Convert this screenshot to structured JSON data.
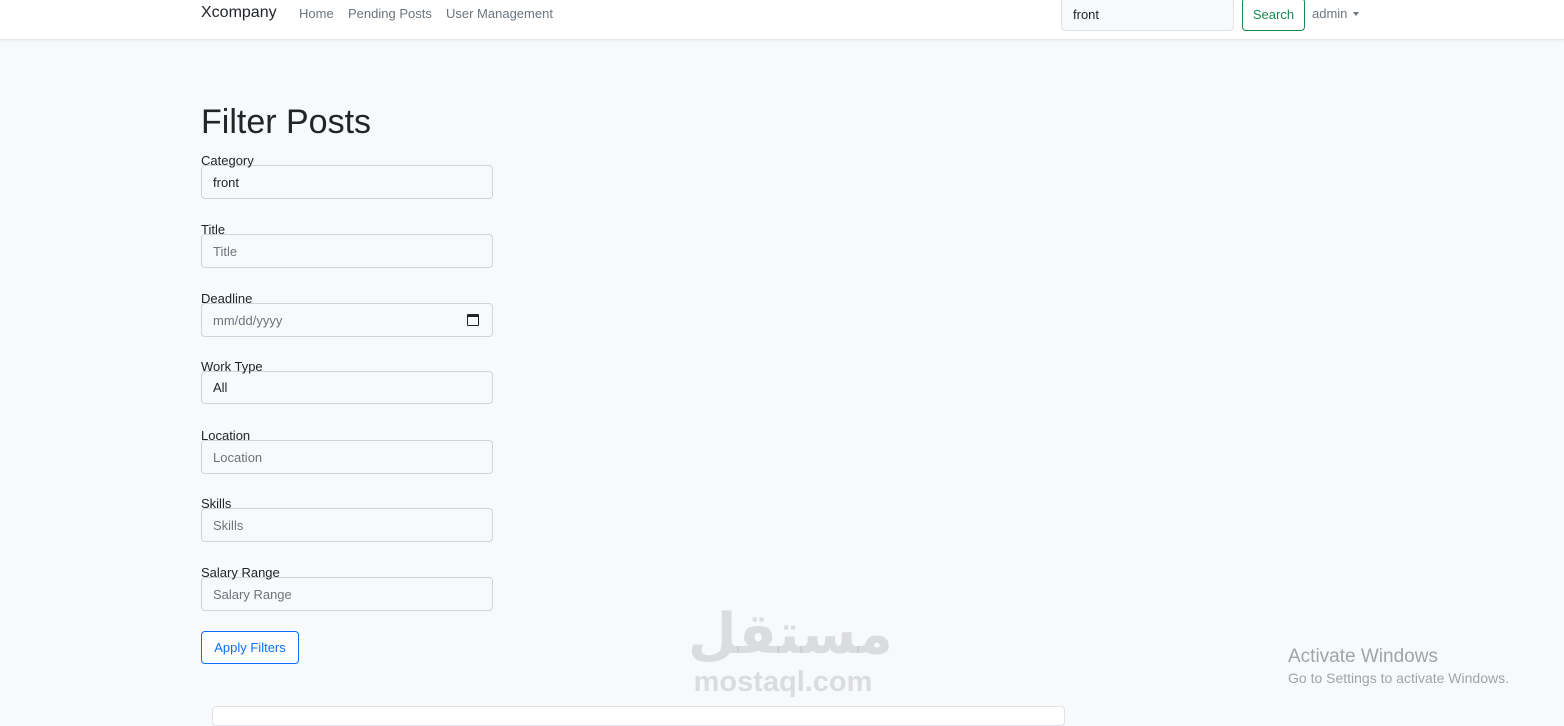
{
  "navbar": {
    "brand": "Xcompany",
    "links": [
      "Home",
      "Pending Posts",
      "User Management"
    ],
    "search_value": "front",
    "search_button": "Search",
    "user": "admin"
  },
  "page_title": "Filter Posts",
  "filters": {
    "category": {
      "label": "Category",
      "value": "front"
    },
    "title": {
      "label": "Title",
      "placeholder": "Title"
    },
    "deadline": {
      "label": "Deadline",
      "placeholder": "mm/dd/yyyy"
    },
    "work_type": {
      "label": "Work Type",
      "value": "All"
    },
    "location": {
      "label": "Location",
      "placeholder": "Location"
    },
    "skills": {
      "label": "Skills",
      "placeholder": "Skills"
    },
    "salary_range": {
      "label": "Salary Range",
      "placeholder": "Salary Range"
    }
  },
  "apply_button": "Apply Filters",
  "watermark": {
    "arabic": "مستقل",
    "latin": "mostaql.com"
  },
  "windows_notice": {
    "title": "Activate Windows",
    "subtitle": "Go to Settings to activate Windows."
  },
  "colors": {
    "page_bg": "#f8f9fa",
    "search_button": "#198754",
    "apply_button": "#0d6efd"
  }
}
